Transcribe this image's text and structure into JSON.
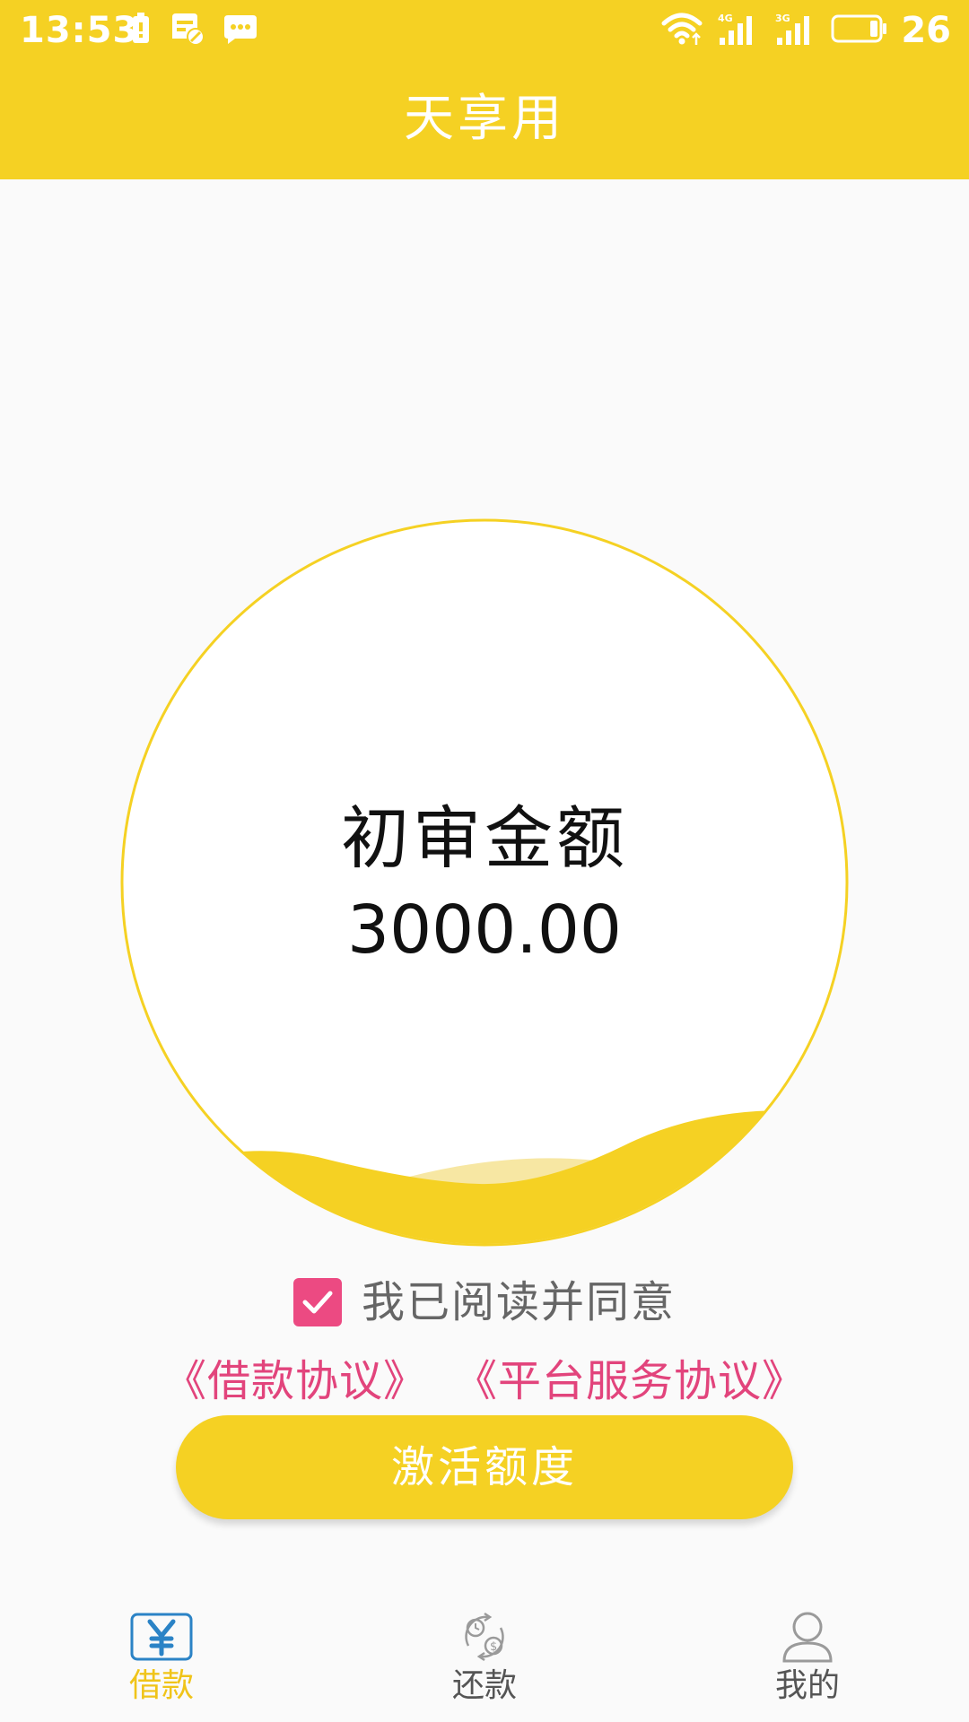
{
  "status_bar": {
    "time": "13:53",
    "network_1": "4G",
    "network_2": "3G",
    "battery_level": "26"
  },
  "header": {
    "title": "天享用"
  },
  "amount_card": {
    "label": "初审金额",
    "value": "3000.00"
  },
  "agreement": {
    "checked": true,
    "text": "我已阅读并同意",
    "links": [
      "《借款协议》",
      "《平台服务协议》"
    ]
  },
  "activate_button": {
    "label": "激活额度"
  },
  "bottom_nav": {
    "items": [
      {
        "label": "借款",
        "icon": "yen-icon",
        "active": true
      },
      {
        "label": "还款",
        "icon": "repay-icon",
        "active": false
      },
      {
        "label": "我的",
        "icon": "user-icon",
        "active": false
      }
    ]
  },
  "colors": {
    "brand_yellow": "#f5d123",
    "checkbox_pink": "#ec4a82",
    "link_pink": "#e2447c",
    "active_nav_label": "#f0c419",
    "active_nav_icon": "#2b83c6"
  }
}
